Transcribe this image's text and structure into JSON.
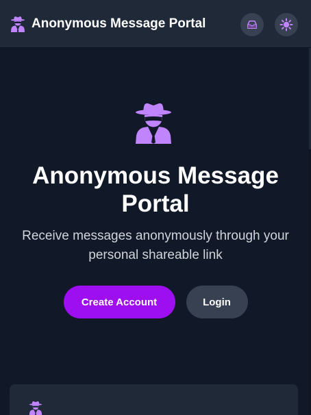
{
  "header": {
    "title": "Anonymous Message Portal",
    "brand_icon": "spy-icon",
    "actions": [
      {
        "name": "inbox-icon",
        "label": ""
      },
      {
        "name": "sun-icon",
        "label": ""
      }
    ]
  },
  "hero": {
    "icon": "spy-icon",
    "title_line1": "Anonymous Message",
    "title_line2": "Portal",
    "subtitle_line1": "Receive messages anonymously through your",
    "subtitle_line2": "personal shareable link"
  },
  "buttons": {
    "create_account": "Create Account",
    "login": "Login"
  },
  "colors": {
    "background": "#111827",
    "header": "#1f2937",
    "accent": "#9d0ff0",
    "icon_purple": "#c084fc",
    "secondary_button": "#374151"
  }
}
